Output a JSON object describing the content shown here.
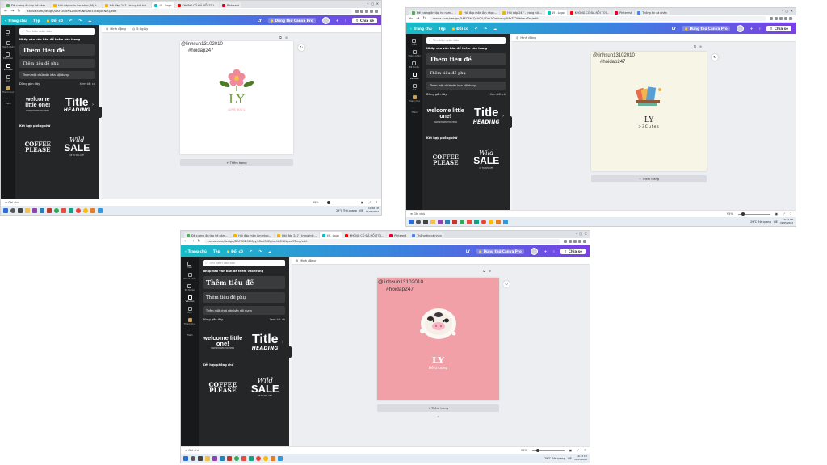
{
  "screenshots": [
    {
      "tabs": [
        "Đề cương ôn tập hè năm...",
        "Hỏi đáp môn Âm nhạc, Mỹ t...",
        "Hỏi đáp 247 - trang hỏi bài...",
        "LY - Logo",
        "KHÔNG CỐ ĐÃ NỔI TỚI...",
        "Pinterest"
      ],
      "url": "canva.com/design/DAFCB5tN4Z5Kr9uNIGzEt1Kt6/joxNqQ/edit",
      "header": {
        "home": "Trang chủ",
        "file": "Tệp",
        "resize": "Đổi cỡ",
        "design_name": "LY",
        "pro": "Dùng thử Canva Pro",
        "share": "Chia sẻ"
      },
      "toolbar": {
        "animate": "Hình động",
        "duration": "5.0giây"
      },
      "handle": "@linhsun13102010",
      "hashtag": "#hoidap247",
      "logo_title": "LY",
      "logo_sub": "LOVE YOU L",
      "status": {
        "notes": "Ghi chú",
        "zoom": "95%",
        "weather": "29°C Trời quang",
        "lang": "VIE",
        "time": "10:08 CH",
        "date": "31/05/2022"
      }
    },
    {
      "tabs": [
        "Đề cương ôn tập hè năm...",
        "Hỏi đáp môn Âm nhạc...",
        "Hỏi đáp 247 - trang hỏi...",
        "LY - Logo",
        "KHÔNG CỐ ĐÃ NỔI TỚI...",
        "Pinterest",
        "Thông tin cá nhân"
      ],
      "url": "canva.com/design/DAFCRtCQxAQA/-Dm1f2mhwuyIK6rTK2HbkeufDw/edit",
      "header": {
        "home": "Trang chủ",
        "file": "Tệp",
        "resize": "Đổi cỡ",
        "design_name": "LY",
        "pro": "Dùng thử Canva Pro",
        "share": "Chia sẻ"
      },
      "toolbar": {
        "animate": "Hình động"
      },
      "handle": "@linhsun13102010",
      "hashtag": "#hoidap247",
      "logo_title": "LY",
      "logo_sub": ">3Cutes",
      "status": {
        "notes": "Ghi chú",
        "zoom": "95%",
        "weather": "29°C Trời quang",
        "lang": "VIE",
        "time": "10:12 CH",
        "date": "31/05/2022"
      }
    },
    {
      "tabs": [
        "Đề cương ôn tập hè năm...",
        "Hỏi đáp môn Âm nhạc...",
        "Hỏi đáp 247 - trang hỏi...",
        "LY - Logo",
        "KHÔNG CỐ ĐÃ NỔI TỚI...",
        "Pinterest",
        "Thông tin cá nhân"
      ],
      "url": "canva.com/design/DAFCBD52Mpy/Mfzd3REp/uU4MNtNpsuMTmg/edit",
      "header": {
        "home": "Trang chủ",
        "file": "Tệp",
        "resize": "Đổi cỡ",
        "design_name": "LY",
        "pro": "Dùng thử Canva Pro",
        "share": "Chia sẻ"
      },
      "toolbar": {
        "animate": "Hình động"
      },
      "handle": "@linhsun13102010",
      "hashtag": "#hoidap247",
      "logo_title": "LY",
      "logo_sub": "Dễ thương",
      "status": {
        "notes": "Ghi chú",
        "zoom": "95%",
        "weather": "29°C Trời quang",
        "lang": "VIE",
        "time": "10:13 CH",
        "date": "31/05/2022"
      }
    }
  ],
  "rail": [
    "Mẫu",
    "Thành phần",
    "Đã tải lên",
    "Văn bản",
    "Ảnh",
    "Thành mục",
    "Thêm"
  ],
  "panel": {
    "search_placeholder": "Tìm kiếm văn bản",
    "intro": "Nhấp vào văn bản để thêm vào trang",
    "heading_btn": "Thêm tiêu đề",
    "subheading_btn": "Thêm tiêu đề phụ",
    "body_btn": "Thêm một chút văn bản nội dung",
    "recent": "Dùng gần đây",
    "see_all": "Xem tất cả",
    "combos": "Kết hợp phông chữ",
    "welcome_text": "welcome little one!",
    "welcome_small": "BABY SHOWER FOR EMMA",
    "title_text": "Title",
    "heading_text": "HEADING",
    "coffee_text": "COFFEE PLEASE",
    "wild_text": "Wild",
    "sale_text": "SALE",
    "sale_small": "UP TO 50% OFF!"
  },
  "add_page": "+ Thêm trang",
  "colors": {
    "page1": "#ffffff",
    "page2": "#f6f5e6",
    "page3": "#f2a0a8",
    "sidepanel": "#252627",
    "rail": "#18191b"
  }
}
